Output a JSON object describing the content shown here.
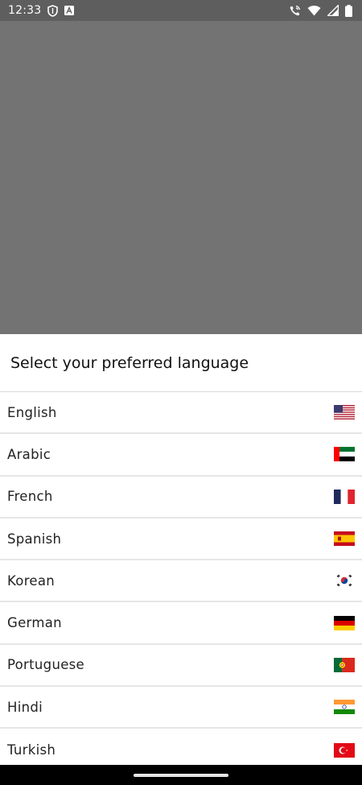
{
  "status_bar": {
    "time": "12:33",
    "left_icons": [
      "shield-icon",
      "app-notification-icon"
    ],
    "right_icons": [
      "wifi-calling-icon",
      "wifi-icon",
      "signal-icon",
      "battery-icon"
    ]
  },
  "sheet": {
    "title": "Select your preferred language",
    "languages": [
      {
        "label": "English",
        "flag": "us-flag-icon"
      },
      {
        "label": "Arabic",
        "flag": "uae-flag-icon"
      },
      {
        "label": "French",
        "flag": "france-flag-icon"
      },
      {
        "label": "Spanish",
        "flag": "spain-flag-icon"
      },
      {
        "label": "Korean",
        "flag": "south-korea-flag-icon"
      },
      {
        "label": "German",
        "flag": "germany-flag-icon"
      },
      {
        "label": "Portuguese",
        "flag": "portugal-flag-icon"
      },
      {
        "label": "Hindi",
        "flag": "india-flag-icon"
      },
      {
        "label": "Turkish",
        "flag": "turkey-flag-icon"
      }
    ]
  },
  "colors": {
    "scrim": "#737373",
    "status_bar": "#5e5e5e",
    "sheet_background": "#ffffff",
    "nav_bar": "#000000"
  }
}
